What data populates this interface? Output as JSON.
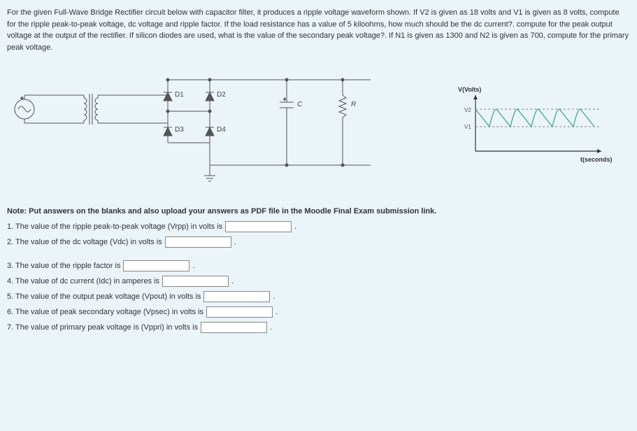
{
  "problem_text": "For the given Full-Wave Bridge Rectifier circuit below with capacitor filter, it produces a ripple voltage waveform shown. If V2 is given as 18 volts and V1 is given as 8 volts, compute for the ripple peak-to-peak voltage, dc voltage and ripple factor. If the load resistance has a value of 5 kiloohms, how much should be the dc current?. compute for the peak output voltage at the output of the rectifier. If silicon diodes are used, what is the value of the secondary peak voltage?. If N1 is given as 1300 and N2 is given as 700, compute for the primary peak voltage.",
  "circuit": {
    "d1": "D1",
    "d2": "D2",
    "d3": "D3",
    "d4": "D4",
    "c": "C",
    "r": "R"
  },
  "waveform": {
    "ylabel": "V(Volts)",
    "v2": "V2",
    "v1": "V1",
    "xlabel": "t(seconds)"
  },
  "note": "Note: Put answers on the blanks and also upload your answers as PDF file in the Moodle Final Exam submission link.",
  "questions": {
    "q1": "1. The value of the ripple peak-to-peak voltage (Vrpp) in volts is",
    "q2": "2. The value of the dc voltage (Vdc) in volts is",
    "q3": "3.  The value of the ripple factor is",
    "q4": "4. The value of dc current (Idc) in amperes is",
    "q5": "5. The value of the output peak voltage (Vpout) in volts is",
    "q6": "6. The value of peak secondary voltage (Vpsec) in volts is",
    "q7": "7. The value of primary peak voltage is (Vppri) in volts is"
  },
  "period": "."
}
